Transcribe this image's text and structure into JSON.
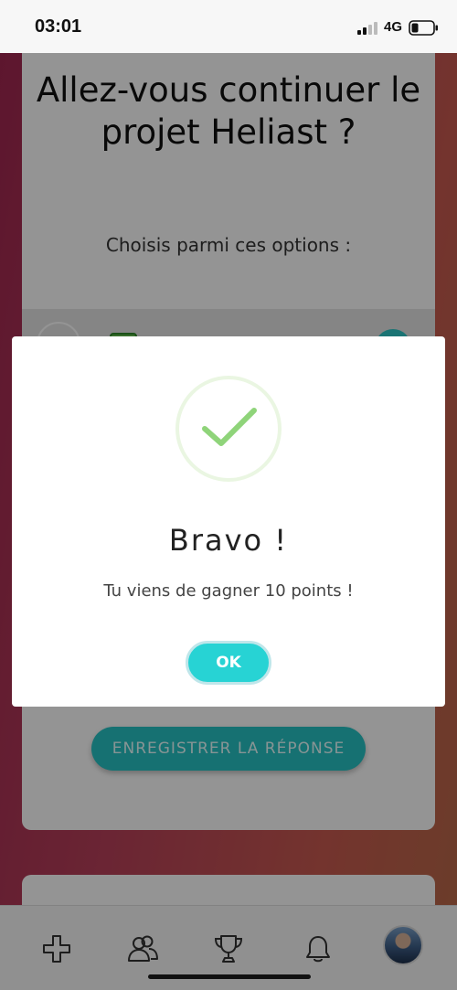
{
  "status_bar": {
    "time": "03:01",
    "network": "4G",
    "icons": [
      "signal-icon",
      "battery-icon"
    ]
  },
  "question": {
    "title": "Allez-vous continuer le projet Heliast ?",
    "subtitle": "Choisis parmi ces options :",
    "save_label": "ENREGISTRER LA RÉPONSE"
  },
  "modal": {
    "icon": "check-icon",
    "title": "Bravo !",
    "message": "Tu viens de gagner 10 points !",
    "ok_label": "OK"
  },
  "tab_bar": {
    "icons": [
      "add-icon",
      "community-icon",
      "trophy-icon",
      "bell-icon",
      "avatar"
    ]
  },
  "colors": {
    "accent": "#27d3d4",
    "success": "#8fd47a",
    "background_start": "#a02650",
    "background_end": "#b86a48"
  }
}
